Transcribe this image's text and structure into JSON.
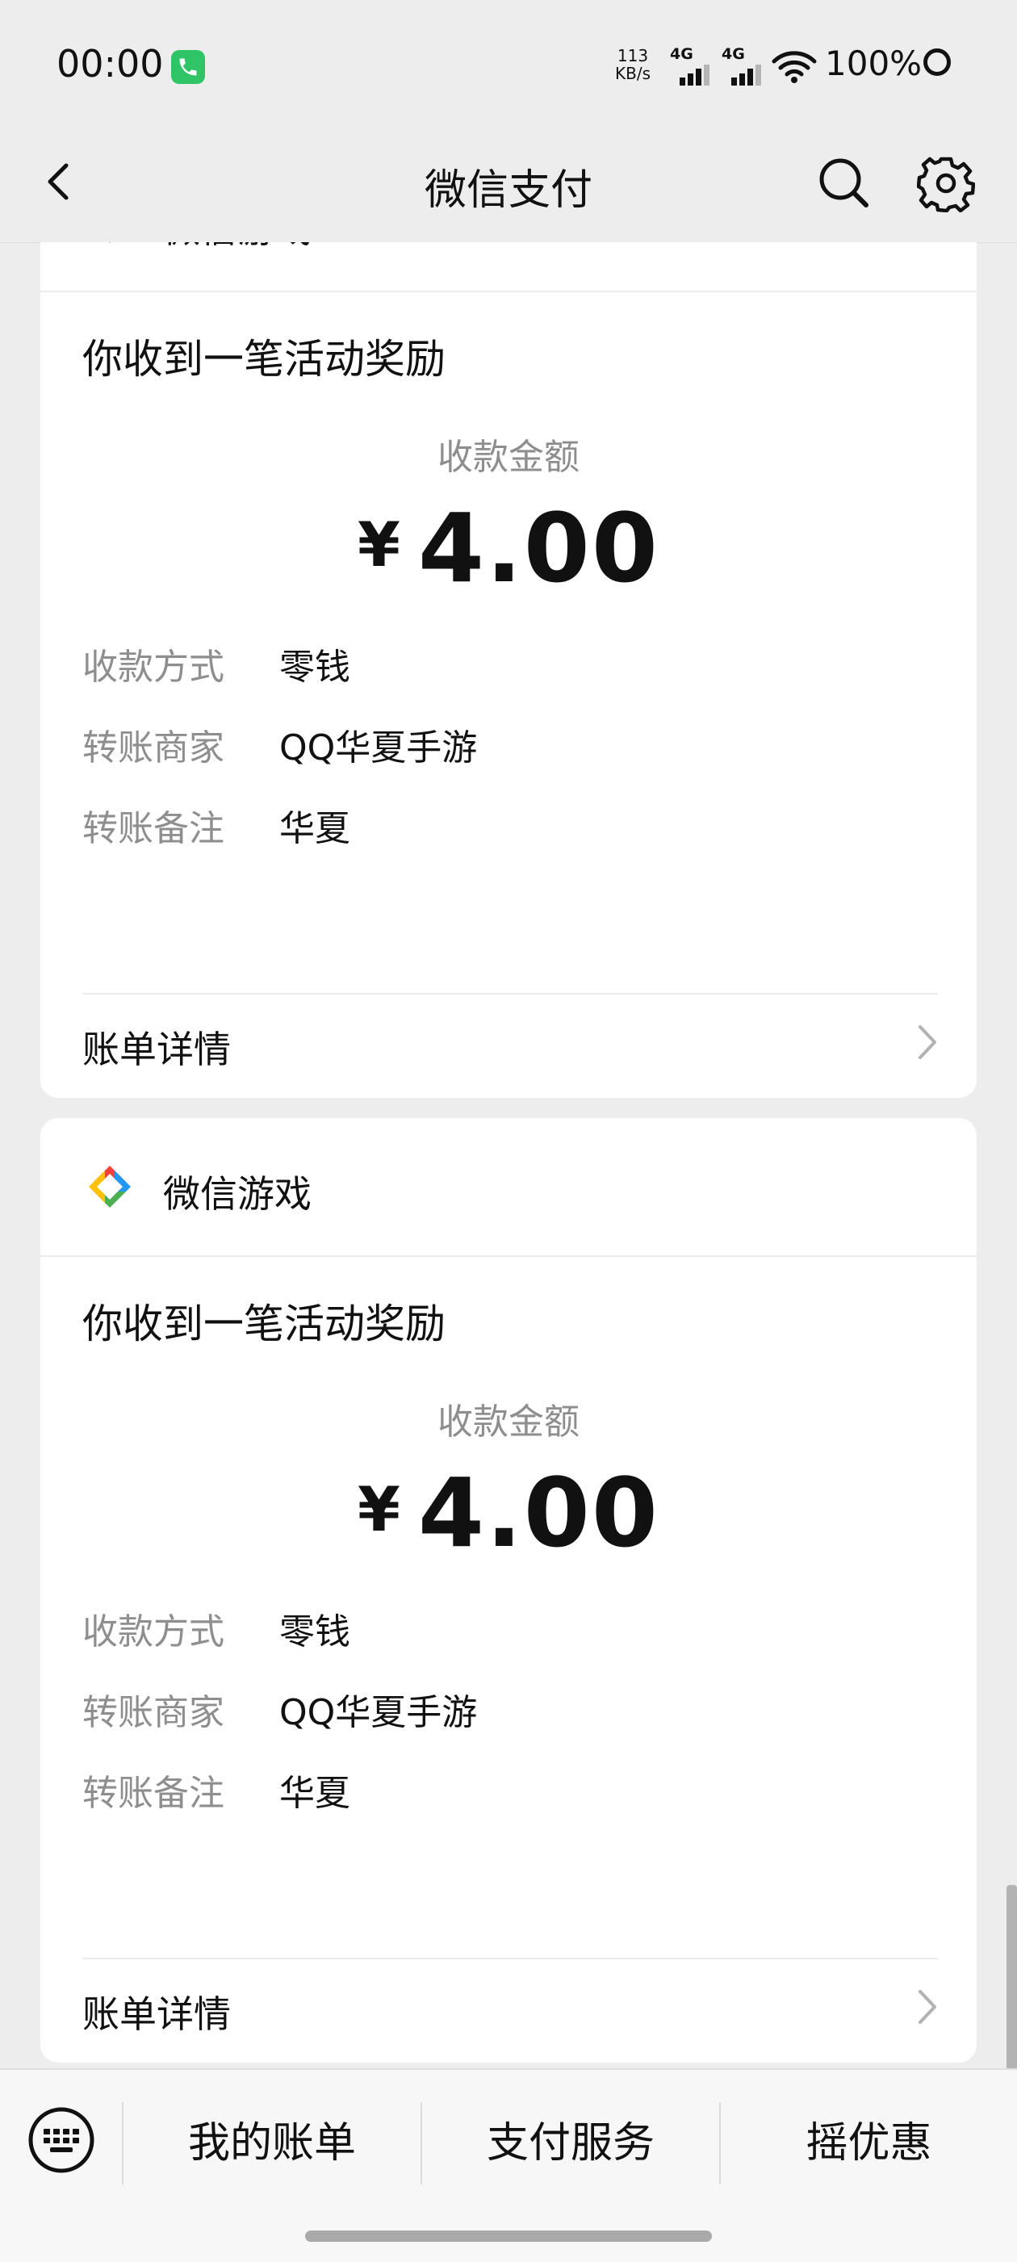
{
  "status": {
    "time": "00:00",
    "net_speed_value": "113",
    "net_speed_unit": "KB/s",
    "sim1": "4G",
    "sim2": "4G",
    "battery": "100%"
  },
  "nav": {
    "title": "微信支付",
    "icons": [
      "back-arrow-icon",
      "search-icon",
      "gear-icon"
    ]
  },
  "cards": [
    {
      "brand": "微信游戏",
      "headline": "你收到一笔活动奖励",
      "amount_label": "收款金额",
      "currency": "¥",
      "amount": "4.00",
      "rows": [
        {
          "key": "收款方式",
          "value": "零钱"
        },
        {
          "key": "转账商家",
          "value": "QQ华夏手游"
        },
        {
          "key": "转账备注",
          "value": "华夏"
        }
      ],
      "detail_label": "账单详情"
    },
    {
      "brand": "微信游戏",
      "headline": "你收到一笔活动奖励",
      "amount_label": "收款金额",
      "currency": "¥",
      "amount": "4.00",
      "rows": [
        {
          "key": "收款方式",
          "value": "零钱"
        },
        {
          "key": "转账商家",
          "value": "QQ华夏手游"
        },
        {
          "key": "转账备注",
          "value": "华夏"
        }
      ],
      "detail_label": "账单详情"
    }
  ],
  "bottom_tabs": [
    {
      "label": "我的账单"
    },
    {
      "label": "支付服务"
    },
    {
      "label": "摇优惠"
    }
  ],
  "colors": {
    "background": "#ededed",
    "card": "#ffffff",
    "call_badge": "#2fc566",
    "muted_text": "#8e8e8e"
  }
}
